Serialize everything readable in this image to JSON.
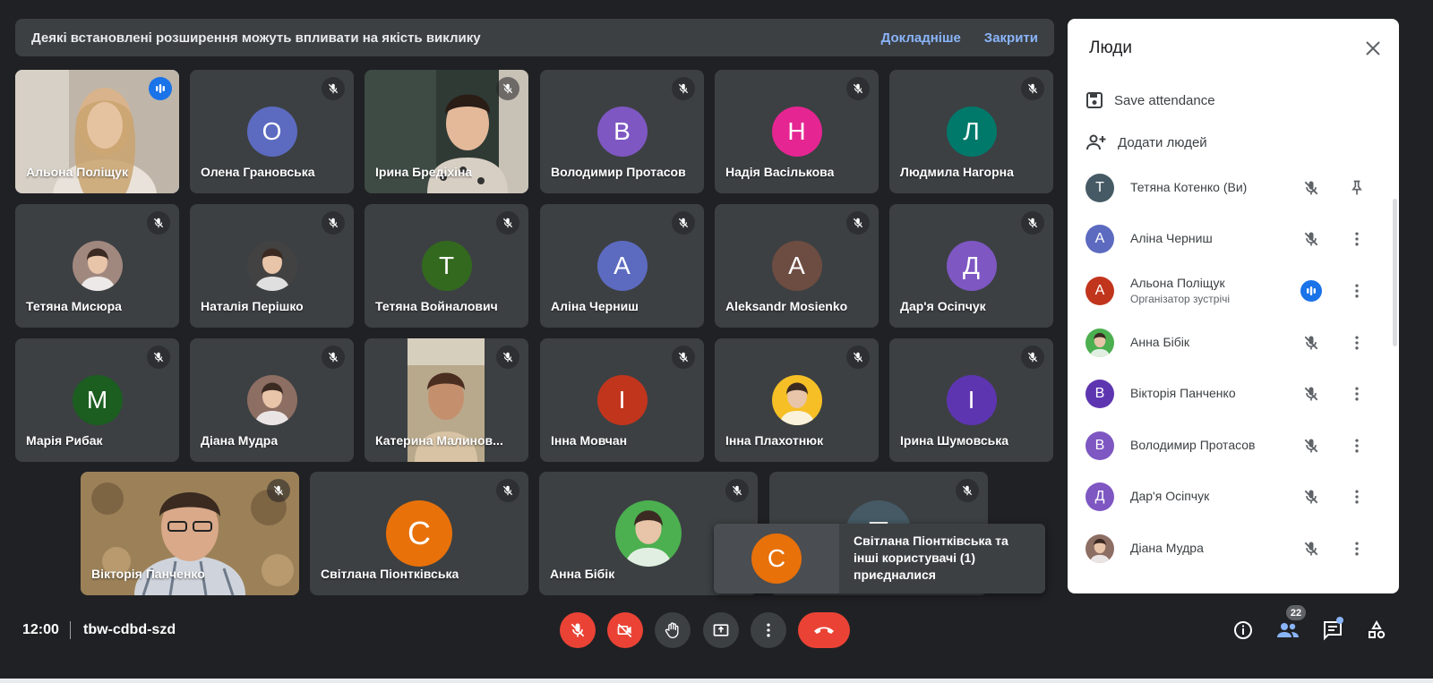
{
  "banner": {
    "message": "Деякі встановлені розширення можуть впливати на якість виклику",
    "learn_more": "Докладніше",
    "close": "Закрити"
  },
  "tiles": [
    {
      "name": "Альона Поліщук",
      "initial": "",
      "color": "",
      "type": "video",
      "speaking": true
    },
    {
      "name": "Олена Грановська",
      "initial": "О",
      "color": "#5c6bc0",
      "type": "initial"
    },
    {
      "name": "Ірина Бредіхіна",
      "initial": "",
      "color": "",
      "type": "video"
    },
    {
      "name": "Володимир Протасов",
      "initial": "В",
      "color": "#7e57c2",
      "type": "initial"
    },
    {
      "name": "Надія Васількова",
      "initial": "Н",
      "color": "#e52592",
      "type": "initial"
    },
    {
      "name": "Людмила Нагорна",
      "initial": "Л",
      "color": "#00796b",
      "type": "initial"
    },
    {
      "name": "Тетяна Мисюра",
      "initial": "",
      "color": "#a1887f",
      "type": "photo"
    },
    {
      "name": "Наталія Перішко",
      "initial": "",
      "color": "#424242",
      "type": "photo"
    },
    {
      "name": "Тетяна Войналович",
      "initial": "Т",
      "color": "#33691e",
      "type": "initial"
    },
    {
      "name": "Аліна Черниш",
      "initial": "А",
      "color": "#5c6bc0",
      "type": "initial"
    },
    {
      "name": "Aleksandr Mosienko",
      "initial": "А",
      "color": "#6d4c41",
      "type": "initial"
    },
    {
      "name": "Дар'я Осіпчук",
      "initial": "Д",
      "color": "#7e57c2",
      "type": "initial"
    },
    {
      "name": "Марія Рибак",
      "initial": "М",
      "color": "#1b5e20",
      "type": "initial"
    },
    {
      "name": "Діана Мудра",
      "initial": "",
      "color": "#8d6e63",
      "type": "photo"
    },
    {
      "name": "Катерина Малинов...",
      "initial": "",
      "color": "",
      "type": "video"
    },
    {
      "name": "Інна Мовчан",
      "initial": "І",
      "color": "#c1351d",
      "type": "initial"
    },
    {
      "name": "Інна Плахотнюк",
      "initial": "",
      "color": "#f6bf26",
      "type": "photo"
    },
    {
      "name": "Ірина Шумовська",
      "initial": "І",
      "color": "#5e35b1",
      "type": "initial"
    },
    {
      "name": "Вікторія Панченко",
      "initial": "",
      "color": "",
      "type": "video"
    },
    {
      "name": "Світлана Піонтківська",
      "initial": "С",
      "color": "#e8710a",
      "type": "initial"
    },
    {
      "name": "Анна Бібік",
      "initial": "",
      "color": "#4caf50",
      "type": "photo"
    },
    {
      "name": "",
      "initial": "Т",
      "color": "#455a64",
      "type": "initial"
    }
  ],
  "toast": {
    "initial": "С",
    "message": "Світлана Піонтківська та інші користувачі (1) приєдналися"
  },
  "meeting": {
    "time": "12:00",
    "code": "tbw-cdbd-szd",
    "participant_count": "22"
  },
  "panel": {
    "title": "Люди",
    "save_attendance": "Save attendance",
    "add_people": "Додати людей",
    "people": [
      {
        "name": "Тетяна Котенко (Ви)",
        "role": "",
        "initial": "Т",
        "color": "#455a64",
        "photo": false,
        "speaking": false,
        "action": "pin"
      },
      {
        "name": "Аліна Черниш",
        "role": "",
        "initial": "А",
        "color": "#5c6bc0",
        "photo": false,
        "speaking": false,
        "action": "more"
      },
      {
        "name": "Альона Поліщук",
        "role": "Організатор зустрічі",
        "initial": "А",
        "color": "#c1351d",
        "photo": false,
        "speaking": true,
        "action": "more"
      },
      {
        "name": "Анна Бібік",
        "role": "",
        "initial": "",
        "color": "#4caf50",
        "photo": true,
        "speaking": false,
        "action": "more"
      },
      {
        "name": "Вікторія Панченко",
        "role": "",
        "initial": "В",
        "color": "#5e35b1",
        "photo": false,
        "speaking": false,
        "action": "more"
      },
      {
        "name": "Володимир Протасов",
        "role": "",
        "initial": "В",
        "color": "#7e57c2",
        "photo": false,
        "speaking": false,
        "action": "more"
      },
      {
        "name": "Дар'я Осіпчук",
        "role": "",
        "initial": "Д",
        "color": "#7e57c2",
        "photo": false,
        "speaking": false,
        "action": "more"
      },
      {
        "name": "Діана Мудра",
        "role": "",
        "initial": "",
        "color": "#8d6e63",
        "photo": true,
        "speaking": false,
        "action": "more"
      }
    ]
  }
}
